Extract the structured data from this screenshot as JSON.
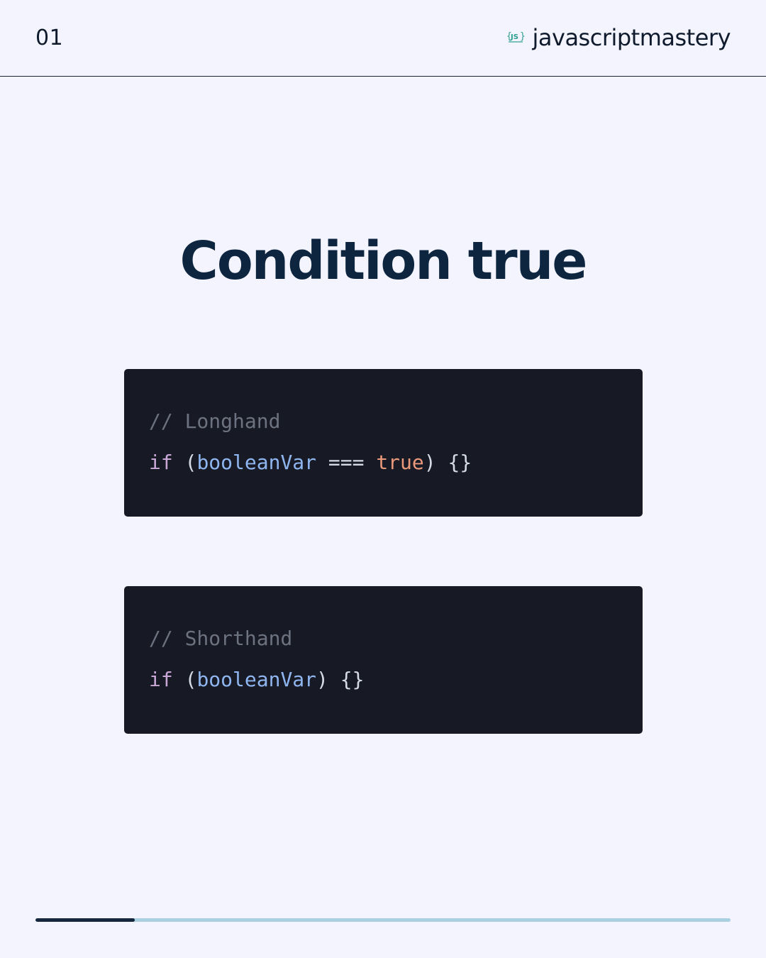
{
  "header": {
    "page_number": "01",
    "brand_name": "javascriptmastery",
    "logo_icon": "js-mastery-logo-icon"
  },
  "title": "Condition true",
  "snippets": [
    {
      "comment": "// Longhand",
      "statement": {
        "keyword": "if",
        "open_paren": "(",
        "variable": "booleanVar",
        "operator": "===",
        "value": "true",
        "close_paren": ")",
        "braces": "{}"
      }
    },
    {
      "comment": "// Shorthand",
      "statement": {
        "keyword": "if",
        "open_paren": "(",
        "variable": "booleanVar",
        "close_paren": ")",
        "braces": "{}"
      }
    }
  ],
  "progress": {
    "fraction": 0.143
  },
  "colors": {
    "background": "#f3f4fd",
    "title": "#0e2540",
    "code_background": "#171a24",
    "comment": "#6d7280",
    "keyword": "#c9a8d8",
    "variable": "#8fb6f0",
    "boolean": "#ea9a7b",
    "progress_track": "#a9cfe0",
    "progress_fill": "#14273f"
  }
}
